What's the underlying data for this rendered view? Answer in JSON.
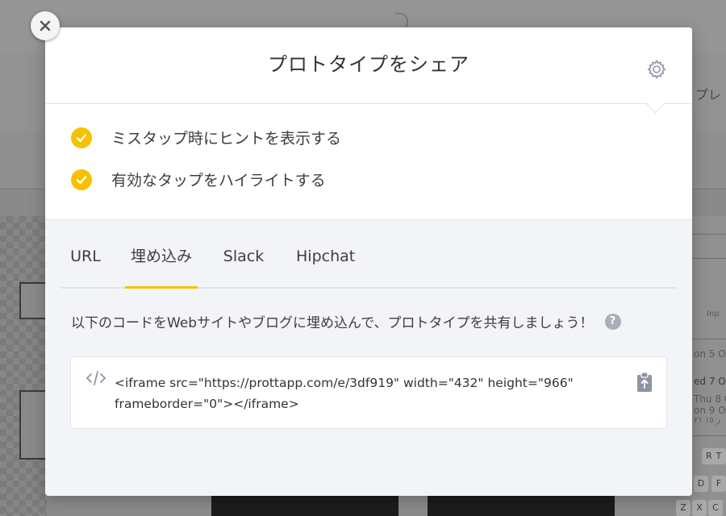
{
  "background": {
    "right_label": "プレ",
    "right_texts": [
      "Inp",
      "on 5 O",
      "ed 7 O",
      "Thu 8 O",
      "on 9 O",
      "ر ١٥ ٢١"
    ],
    "keys": [
      "R",
      "T",
      "D",
      "F",
      "Z",
      "X",
      "C"
    ]
  },
  "modal": {
    "title": "プロトタイプをシェア",
    "options": [
      {
        "label": "ミスタップ時にヒントを表示する",
        "checked": true
      },
      {
        "label": "有効なタップをハイライトする",
        "checked": true
      }
    ],
    "tabs": [
      {
        "label": "URL",
        "active": false
      },
      {
        "label": "埋め込み",
        "active": true
      },
      {
        "label": "Slack",
        "active": false
      },
      {
        "label": "Hipchat",
        "active": false
      }
    ],
    "description": "以下のコードをWebサイトやブログに埋め込んで、プロトタイプを共有しましょう！",
    "help_label": "?",
    "embed_code": "<iframe src=\"https://prottapp.com/e/3df919\" width=\"432\" height=\"966\" frameborder=\"0\"></iframe>"
  },
  "colors": {
    "accent": "#f6c100",
    "panel_bg": "#f3f4f8",
    "icon_gray": "#8e94a6"
  },
  "icons": {
    "close": "close-icon",
    "settings": "gear-icon",
    "check": "check-icon",
    "code": "code-icon",
    "copy": "clipboard-icon",
    "help": "question-icon"
  }
}
